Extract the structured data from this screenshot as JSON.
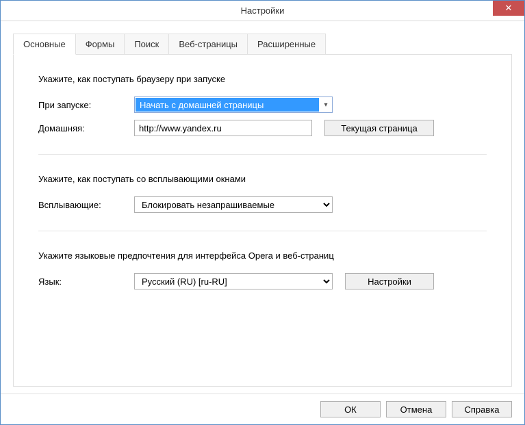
{
  "window": {
    "title": "Настройки",
    "close": "✕"
  },
  "tabs": [
    {
      "label": "Основные"
    },
    {
      "label": "Формы"
    },
    {
      "label": "Поиск"
    },
    {
      "label": "Веб-страницы"
    },
    {
      "label": "Расширенные"
    }
  ],
  "startup": {
    "heading": "Укажите, как поступать браузеру при запуске",
    "on_startup_label": "При запуске:",
    "on_startup_value": "Начать с домашней страницы",
    "home_label": "Домашняя:",
    "home_value": "http://www.yandex.ru",
    "current_page_button": "Текущая страница"
  },
  "popups": {
    "heading": "Укажите, как поступать со всплывающими окнами",
    "label": "Всплывающие:",
    "value": "Блокировать незапрашиваемые"
  },
  "language": {
    "heading": "Укажите языковые предпочтения для интерфейса Opera и веб-страниц",
    "label": "Язык:",
    "value": "Русский (RU) [ru-RU]",
    "settings_button": "Настройки"
  },
  "footer": {
    "ok": "ОК",
    "cancel": "Отмена",
    "help": "Справка"
  }
}
